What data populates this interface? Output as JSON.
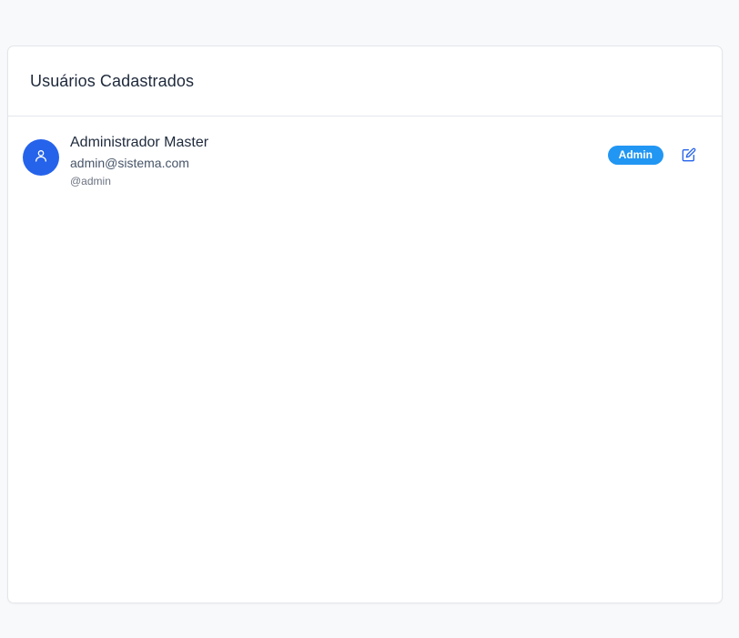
{
  "card": {
    "title": "Usuários Cadastrados"
  },
  "users": [
    {
      "name": "Administrador Master",
      "email": "admin@sistema.com",
      "username": "@admin",
      "role": "Admin",
      "avatar_icon": "user-icon",
      "edit_icon": "edit-icon"
    }
  ],
  "colors": {
    "avatar_bg": "#2563eb",
    "badge_bg": "#2196f3",
    "edit_icon": "#2563eb",
    "page_bg": "#f8f9fb"
  }
}
